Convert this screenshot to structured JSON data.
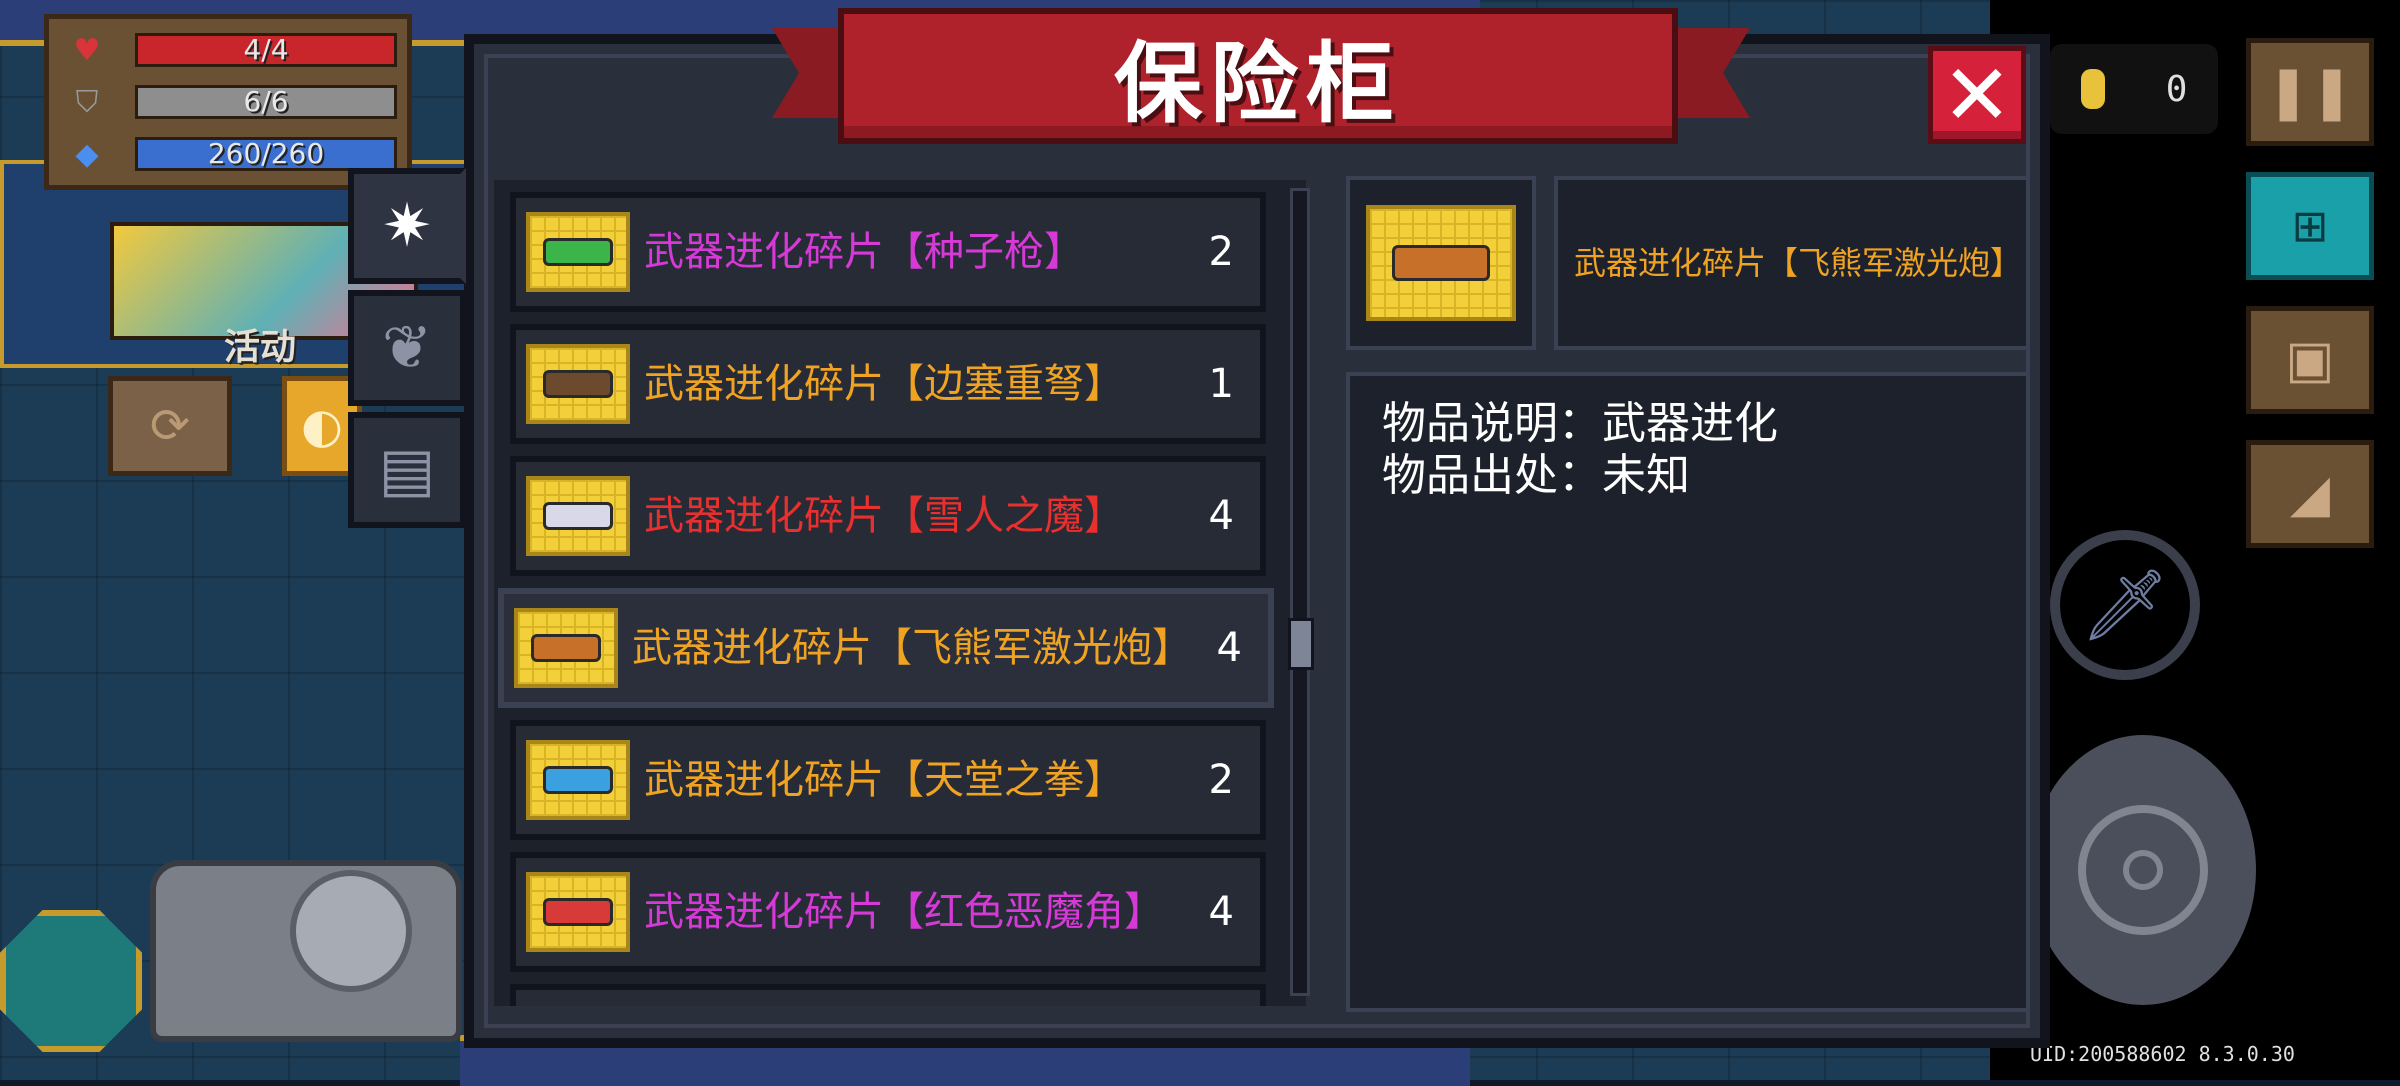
{
  "hud": {
    "hp": "4/4",
    "armor": "6/6",
    "energy": "260/260",
    "colors": {
      "hp": "#c8262b",
      "armor": "#8e8e8e",
      "energy": "#3a6fd0"
    }
  },
  "event": {
    "label": "活动"
  },
  "coins": {
    "count": "0"
  },
  "vault": {
    "title": "保险柜",
    "close_icon": "close-x-icon",
    "tabs": [
      {
        "icon": "sparkle-icon",
        "glyph": "✷",
        "active": true
      },
      {
        "icon": "plant-icon",
        "glyph": "❦",
        "active": false
      },
      {
        "icon": "ticket-icon",
        "glyph": "▤",
        "active": false
      }
    ],
    "items": [
      {
        "name": "武器进化碎片【种子枪】",
        "qty": "2",
        "color": "#d63ad6",
        "gun_color": "#3bb54a"
      },
      {
        "name": "武器进化碎片【边塞重弩】",
        "qty": "1",
        "color": "#f0a322",
        "gun_color": "#6b4a2e"
      },
      {
        "name": "武器进化碎片【雪人之魔】",
        "qty": "4",
        "color": "#e8302f",
        "gun_color": "#d8d8e8"
      },
      {
        "name": "武器进化碎片【飞熊军激光炮】",
        "qty": "4",
        "color": "#f0a322",
        "gun_color": "#c7702a"
      },
      {
        "name": "武器进化碎片【天堂之拳】",
        "qty": "2",
        "color": "#f0a322",
        "gun_color": "#3aa0e0"
      },
      {
        "name": "武器进化碎片【红色恶魔角】",
        "qty": "4",
        "color": "#d63ad6",
        "gun_color": "#d83a3a"
      }
    ],
    "selected_index": 3,
    "detail": {
      "title": "武器进化碎片【飞熊军激光炮】",
      "description_line": "物品说明：武器进化",
      "source_line": "物品出处：未知"
    }
  },
  "right_buttons": [
    {
      "icon": "pause-icon",
      "glyph": "❚❚"
    },
    {
      "icon": "shop-cart-icon",
      "glyph": "🛒"
    },
    {
      "icon": "profile-card-icon",
      "glyph": "▣"
    },
    {
      "icon": "stairs-icon",
      "glyph": "◢"
    }
  ],
  "uid": "UID:200588602 8.3.0.30"
}
